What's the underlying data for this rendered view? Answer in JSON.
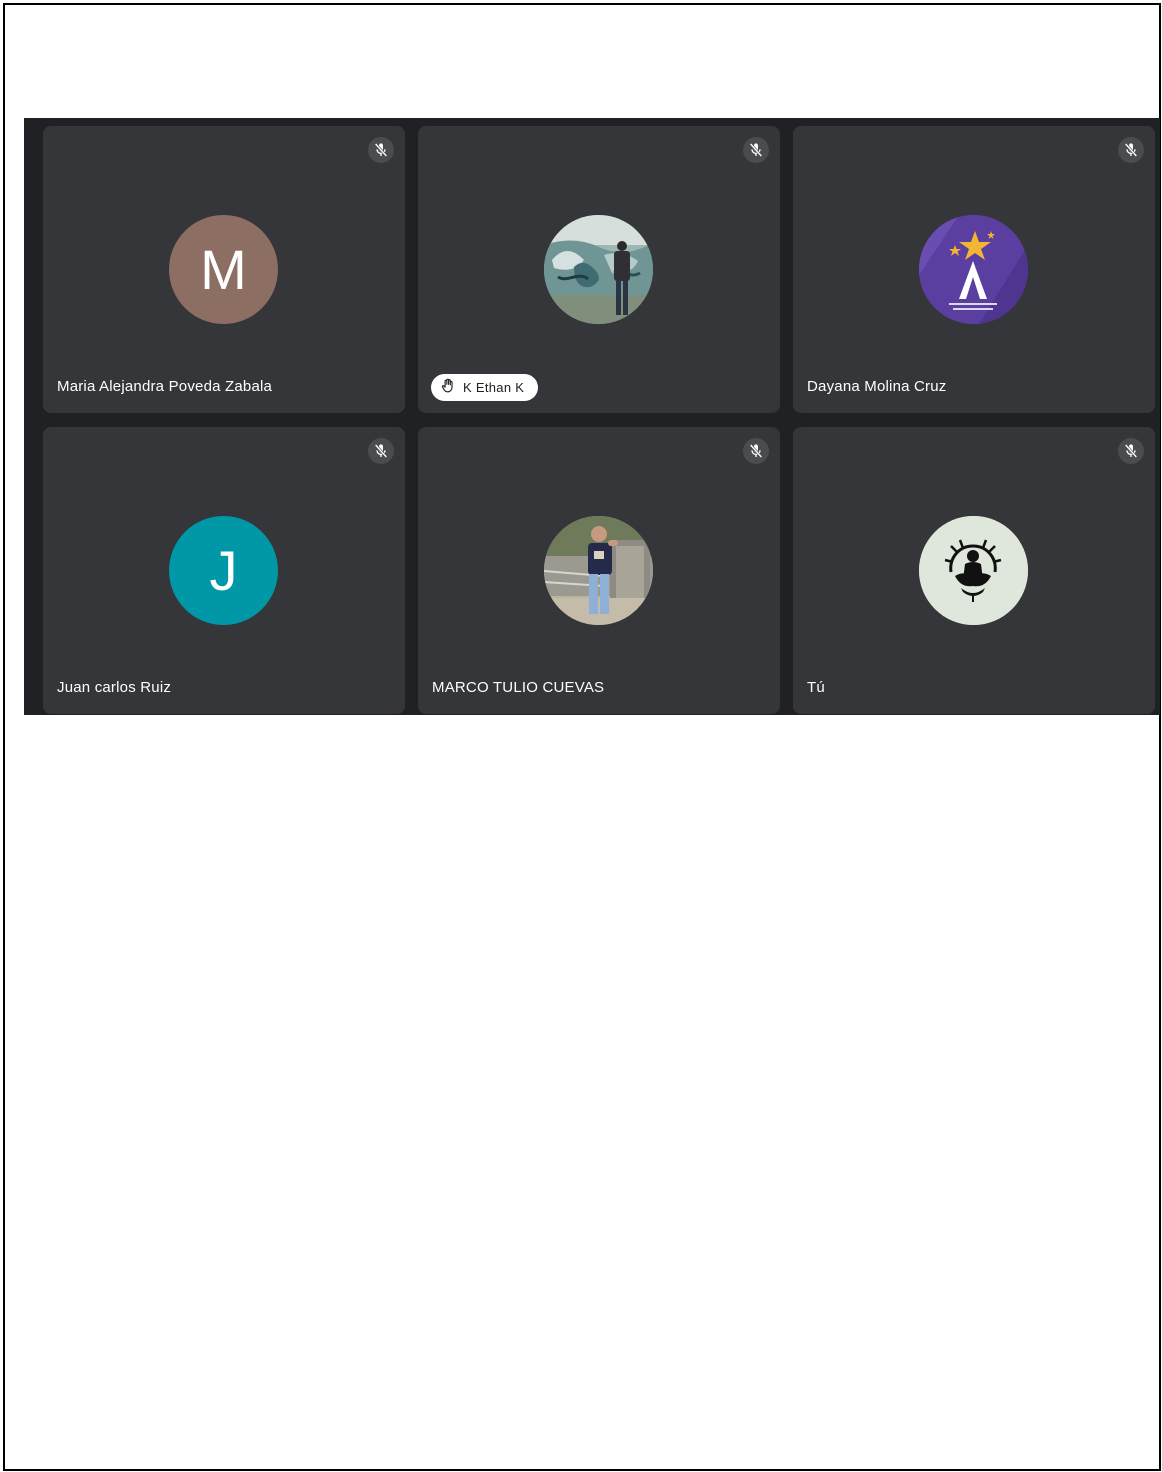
{
  "colors": {
    "stage_background": "#202124",
    "tile_background": "#35363a",
    "chip_background": "#ffffff"
  },
  "participants": [
    {
      "name": "Maria Alejandra Poveda Zabala",
      "avatar_type": "letter",
      "avatar_letter": "M",
      "avatar_color": "#8d6e63",
      "muted": true,
      "icon": "mic-off-icon"
    },
    {
      "name": "K Ethan K",
      "avatar_type": "photo",
      "photo_subject": "graffiti-wall-photo",
      "muted": true,
      "hand_raised": true,
      "icon": "mic-off-icon",
      "hand_icon": "raised-hand-icon"
    },
    {
      "name": "Dayana Molina Cruz",
      "avatar_type": "logo",
      "avatar_color": "#5b3fa0",
      "muted": true,
      "icon": "mic-off-icon"
    },
    {
      "name": "Juan carlos Ruiz",
      "avatar_type": "letter",
      "avatar_letter": "J",
      "avatar_color": "#0097a7",
      "muted": true,
      "icon": "mic-off-icon"
    },
    {
      "name": "MARCO TULIO CUEVAS",
      "avatar_type": "photo",
      "photo_subject": "person-outdoors-photo",
      "muted": true,
      "icon": "mic-off-icon"
    },
    {
      "name": "Tú",
      "avatar_type": "logo",
      "avatar_color": "#dfe6dc",
      "muted": true,
      "icon": "mic-off-icon"
    }
  ]
}
